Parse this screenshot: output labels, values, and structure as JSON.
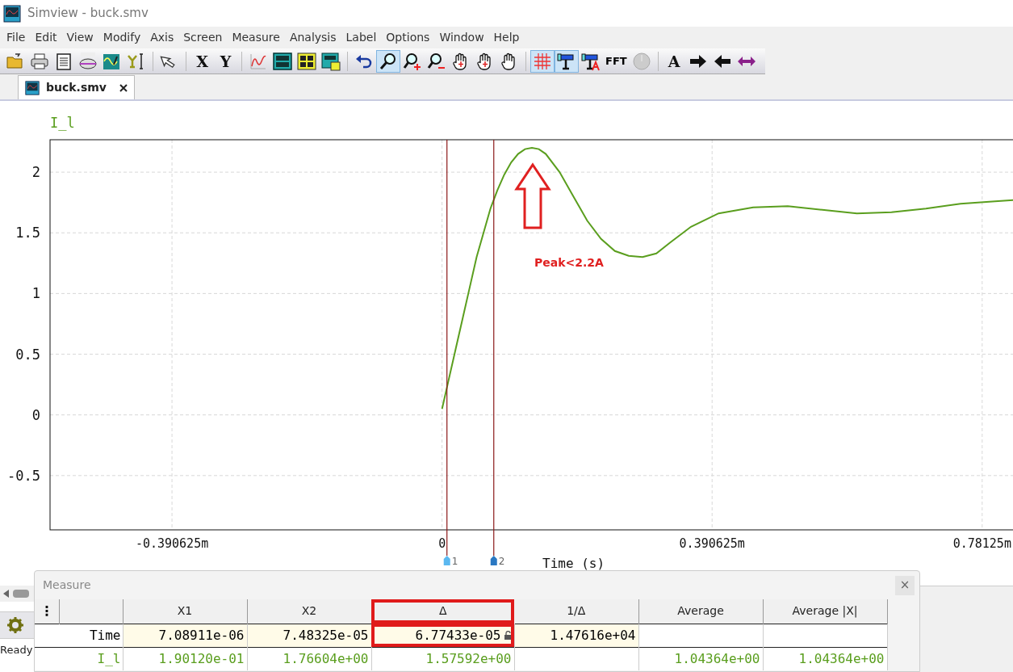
{
  "window": {
    "title": "Simview - buck.smv"
  },
  "menu": [
    "File",
    "Edit",
    "View",
    "Modify",
    "Axis",
    "Screen",
    "Measure",
    "Analysis",
    "Label",
    "Options",
    "Window",
    "Help"
  ],
  "toolbar": [
    {
      "kind": "open",
      "selected": false
    },
    {
      "kind": "print",
      "selected": false
    },
    {
      "kind": "clipboard",
      "selected": false
    },
    {
      "kind": "data",
      "selected": false
    },
    {
      "kind": "wave",
      "selected": false
    },
    {
      "kind": "yscale",
      "selected": false
    },
    {
      "kind": "sep"
    },
    {
      "kind": "pointer",
      "selected": false
    },
    {
      "kind": "sep"
    },
    {
      "kind": "letter",
      "label": "X",
      "selected": false
    },
    {
      "kind": "letter",
      "label": "Y",
      "selected": false
    },
    {
      "kind": "sep"
    },
    {
      "kind": "plot",
      "selected": false
    },
    {
      "kind": "panel",
      "selected": false
    },
    {
      "kind": "quad",
      "selected": false
    },
    {
      "kind": "panelplus",
      "selected": false
    },
    {
      "kind": "sep"
    },
    {
      "kind": "undo",
      "selected": false
    },
    {
      "kind": "zoom",
      "selected": true
    },
    {
      "kind": "zoomin",
      "selected": false
    },
    {
      "kind": "zoomout",
      "selected": false
    },
    {
      "kind": "handmove",
      "selected": false
    },
    {
      "kind": "handzoom",
      "selected": false
    },
    {
      "kind": "hand",
      "selected": false
    },
    {
      "kind": "sep"
    },
    {
      "kind": "grid",
      "selected": true
    },
    {
      "kind": "probe",
      "selected": true
    },
    {
      "kind": "probetext",
      "selected": false
    },
    {
      "kind": "text",
      "label": "FFT",
      "selected": false
    },
    {
      "kind": "clock",
      "selected": false
    },
    {
      "kind": "sep"
    },
    {
      "kind": "letter",
      "label": "A",
      "selected": false
    },
    {
      "kind": "arrowright",
      "selected": false
    },
    {
      "kind": "arrowleft",
      "selected": false
    },
    {
      "kind": "arrowboth",
      "selected": false
    }
  ],
  "tabs": [
    {
      "label": "buck.smv",
      "selected": true
    }
  ],
  "plot": {
    "chart_data": {
      "type": "line",
      "xlabel": "Time (s)",
      "xlim": [
        -0.567,
        0.827
      ],
      "ylim": [
        -0.947,
        2.267
      ],
      "xticks": [
        {
          "value": -0.390625,
          "label": "-0.390625m"
        },
        {
          "value": 0,
          "label": "0"
        },
        {
          "value": 0.390625,
          "label": "0.390625m"
        },
        {
          "value": 0.78125,
          "label": "0.78125m"
        }
      ],
      "yticks": [
        {
          "value": -0.5,
          "label": "-0.5"
        },
        {
          "value": 0,
          "label": "0"
        },
        {
          "value": 0.5,
          "label": "0.5"
        },
        {
          "value": 1,
          "label": "1"
        },
        {
          "value": 1.5,
          "label": "1.5"
        },
        {
          "value": 2,
          "label": "2"
        }
      ],
      "x": [
        0,
        0.01,
        0.02,
        0.03,
        0.04,
        0.05,
        0.06,
        0.07,
        0.08,
        0.09,
        0.1,
        0.11,
        0.12,
        0.13,
        0.14,
        0.15,
        0.17,
        0.19,
        0.21,
        0.23,
        0.25,
        0.27,
        0.29,
        0.31,
        0.33,
        0.36,
        0.4,
        0.45,
        0.5,
        0.55,
        0.6,
        0.65,
        0.7,
        0.75,
        0.8,
        0.827
      ],
      "series": [
        {
          "name": "I_l",
          "color": "#5a9e1e",
          "values": [
            0.05,
            0.3,
            0.55,
            0.8,
            1.05,
            1.3,
            1.5,
            1.7,
            1.85,
            1.98,
            2.08,
            2.15,
            2.19,
            2.2,
            2.19,
            2.15,
            2.0,
            1.8,
            1.6,
            1.45,
            1.35,
            1.31,
            1.3,
            1.33,
            1.42,
            1.55,
            1.66,
            1.71,
            1.72,
            1.69,
            1.66,
            1.67,
            1.7,
            1.74,
            1.76,
            1.77
          ]
        }
      ],
      "grid": true,
      "ref_lines": [
        {
          "axis": "x",
          "value": 0.00708911,
          "color": "#8b1a1a"
        },
        {
          "axis": "x",
          "value": 0.0748325,
          "color": "#8b1a1a"
        }
      ],
      "annotations": [
        "Peak<2.2A"
      ]
    },
    "cursors": [
      {
        "label": "1",
        "color": "#5bb8f0"
      },
      {
        "label": "2",
        "color": "#2a78c2"
      }
    ]
  },
  "measure": {
    "title": "Measure",
    "close": "×",
    "menu": "⋮",
    "columns": [
      {
        "label": "X1",
        "highlighted": false
      },
      {
        "label": "X2",
        "highlighted": false
      },
      {
        "label": "Δ",
        "highlighted": true
      },
      {
        "label": "1/Δ",
        "highlighted": false
      },
      {
        "label": "Average",
        "highlighted": false
      },
      {
        "label": "Average |X|",
        "highlighted": false
      }
    ],
    "rows": [
      {
        "name": "Time",
        "kind": "time",
        "color": "#000000",
        "cells": [
          {
            "text": "7.08911e-06",
            "locked": false
          },
          {
            "text": "7.48325e-05",
            "locked": false
          },
          {
            "text": "6.77433e-05",
            "locked": true
          },
          {
            "text": "1.47616e+04",
            "locked": false
          },
          {
            "locked": false
          },
          {
            "locked": false
          }
        ]
      },
      {
        "name": "I_l",
        "kind": "trace",
        "color": "#5a9e1e",
        "cells": [
          {
            "text": "1.90120e-01",
            "locked": false
          },
          {
            "text": "1.76604e+00",
            "locked": false
          },
          {
            "text": "1.57592e+00",
            "locked": false
          },
          {
            "locked": false
          },
          {
            "text": "1.04364e+00",
            "locked": false
          },
          {
            "text": "1.04364e+00",
            "locked": false
          }
        ]
      }
    ]
  },
  "status_bar": {
    "text": "Ready"
  }
}
